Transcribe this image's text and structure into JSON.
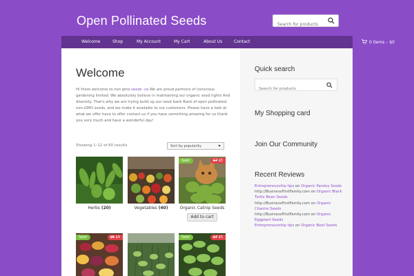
{
  "site": {
    "title": "Open Pollinated Seeds"
  },
  "top_search": {
    "placeholder": "Search for products"
  },
  "nav": {
    "items": [
      "Welcome",
      "Shop",
      "My Account",
      "My Cart",
      "About Us",
      "Contact"
    ],
    "cart": "0 items – $0"
  },
  "main": {
    "heading": "Welcome",
    "intro_before_link": "Hi there welcome to non gmo ",
    "intro_link": "seeds .ca",
    "intro_after_link": " We are proud partners of conscious gardening limited. We absolutely believe in maintaining our organic seed rights And diversity. That's why we are trying build up our seed bank Bank of open pollinated non-GMO seeds, and we make it available to our customers. Please have a look at what we offer have to offer contact us if you have something amazing for us thank you very much and have a wonderful day!",
    "showing": "Showing 1–12 of 60 results",
    "sort_selected": "Sort by popularity",
    "products": [
      {
        "name": "Herbs",
        "count": "(20)"
      },
      {
        "name": "Vegetables",
        "count": "(40)"
      },
      {
        "name": "Organic Catnip Seeds",
        "sale": "Sale!",
        "old_price": "$7",
        "price": "$5"
      }
    ],
    "add_to_cart": "Add to cart",
    "row2": [
      {
        "sale": "Sale!",
        "old_price": "$5",
        "price": "$4"
      },
      {},
      {
        "sale": "Sale!",
        "old_price": "$7",
        "price": "$5"
      }
    ]
  },
  "sidebar": {
    "quick_search": "Quick search",
    "search_placeholder": "Search for products",
    "shopping_card": "My Shopping card",
    "community": "Join Our Community",
    "recent_reviews": "Recent Reviews",
    "reviews": [
      {
        "author": "Entrepreneurship tips",
        "on": " on ",
        "product": "Organic Parsley Seeds"
      },
      {
        "author": "http://BusinessFirstFamily.com",
        "on": " on ",
        "product": "Organic Black Turtle Bean Seeds"
      },
      {
        "author": "http://BusinessFirstFamily.com",
        "on": " on ",
        "product": "Organic Cilantro Seeds"
      },
      {
        "author": "http://BusinessFirstFamily.com",
        "on": " on ",
        "product": "Organic Eggplant Seeds"
      },
      {
        "author": "Entrepreneurship tips",
        "on": " on ",
        "product": "Organic Beet Seeds"
      }
    ]
  },
  "colors": {
    "background": "#8b4cc8",
    "nav": "#62338f",
    "sale": "#7cc043",
    "price_badge": "#e0434a",
    "link": "#8b4cc8"
  },
  "icons": {
    "search": "search-icon",
    "cart": "cart-icon"
  }
}
